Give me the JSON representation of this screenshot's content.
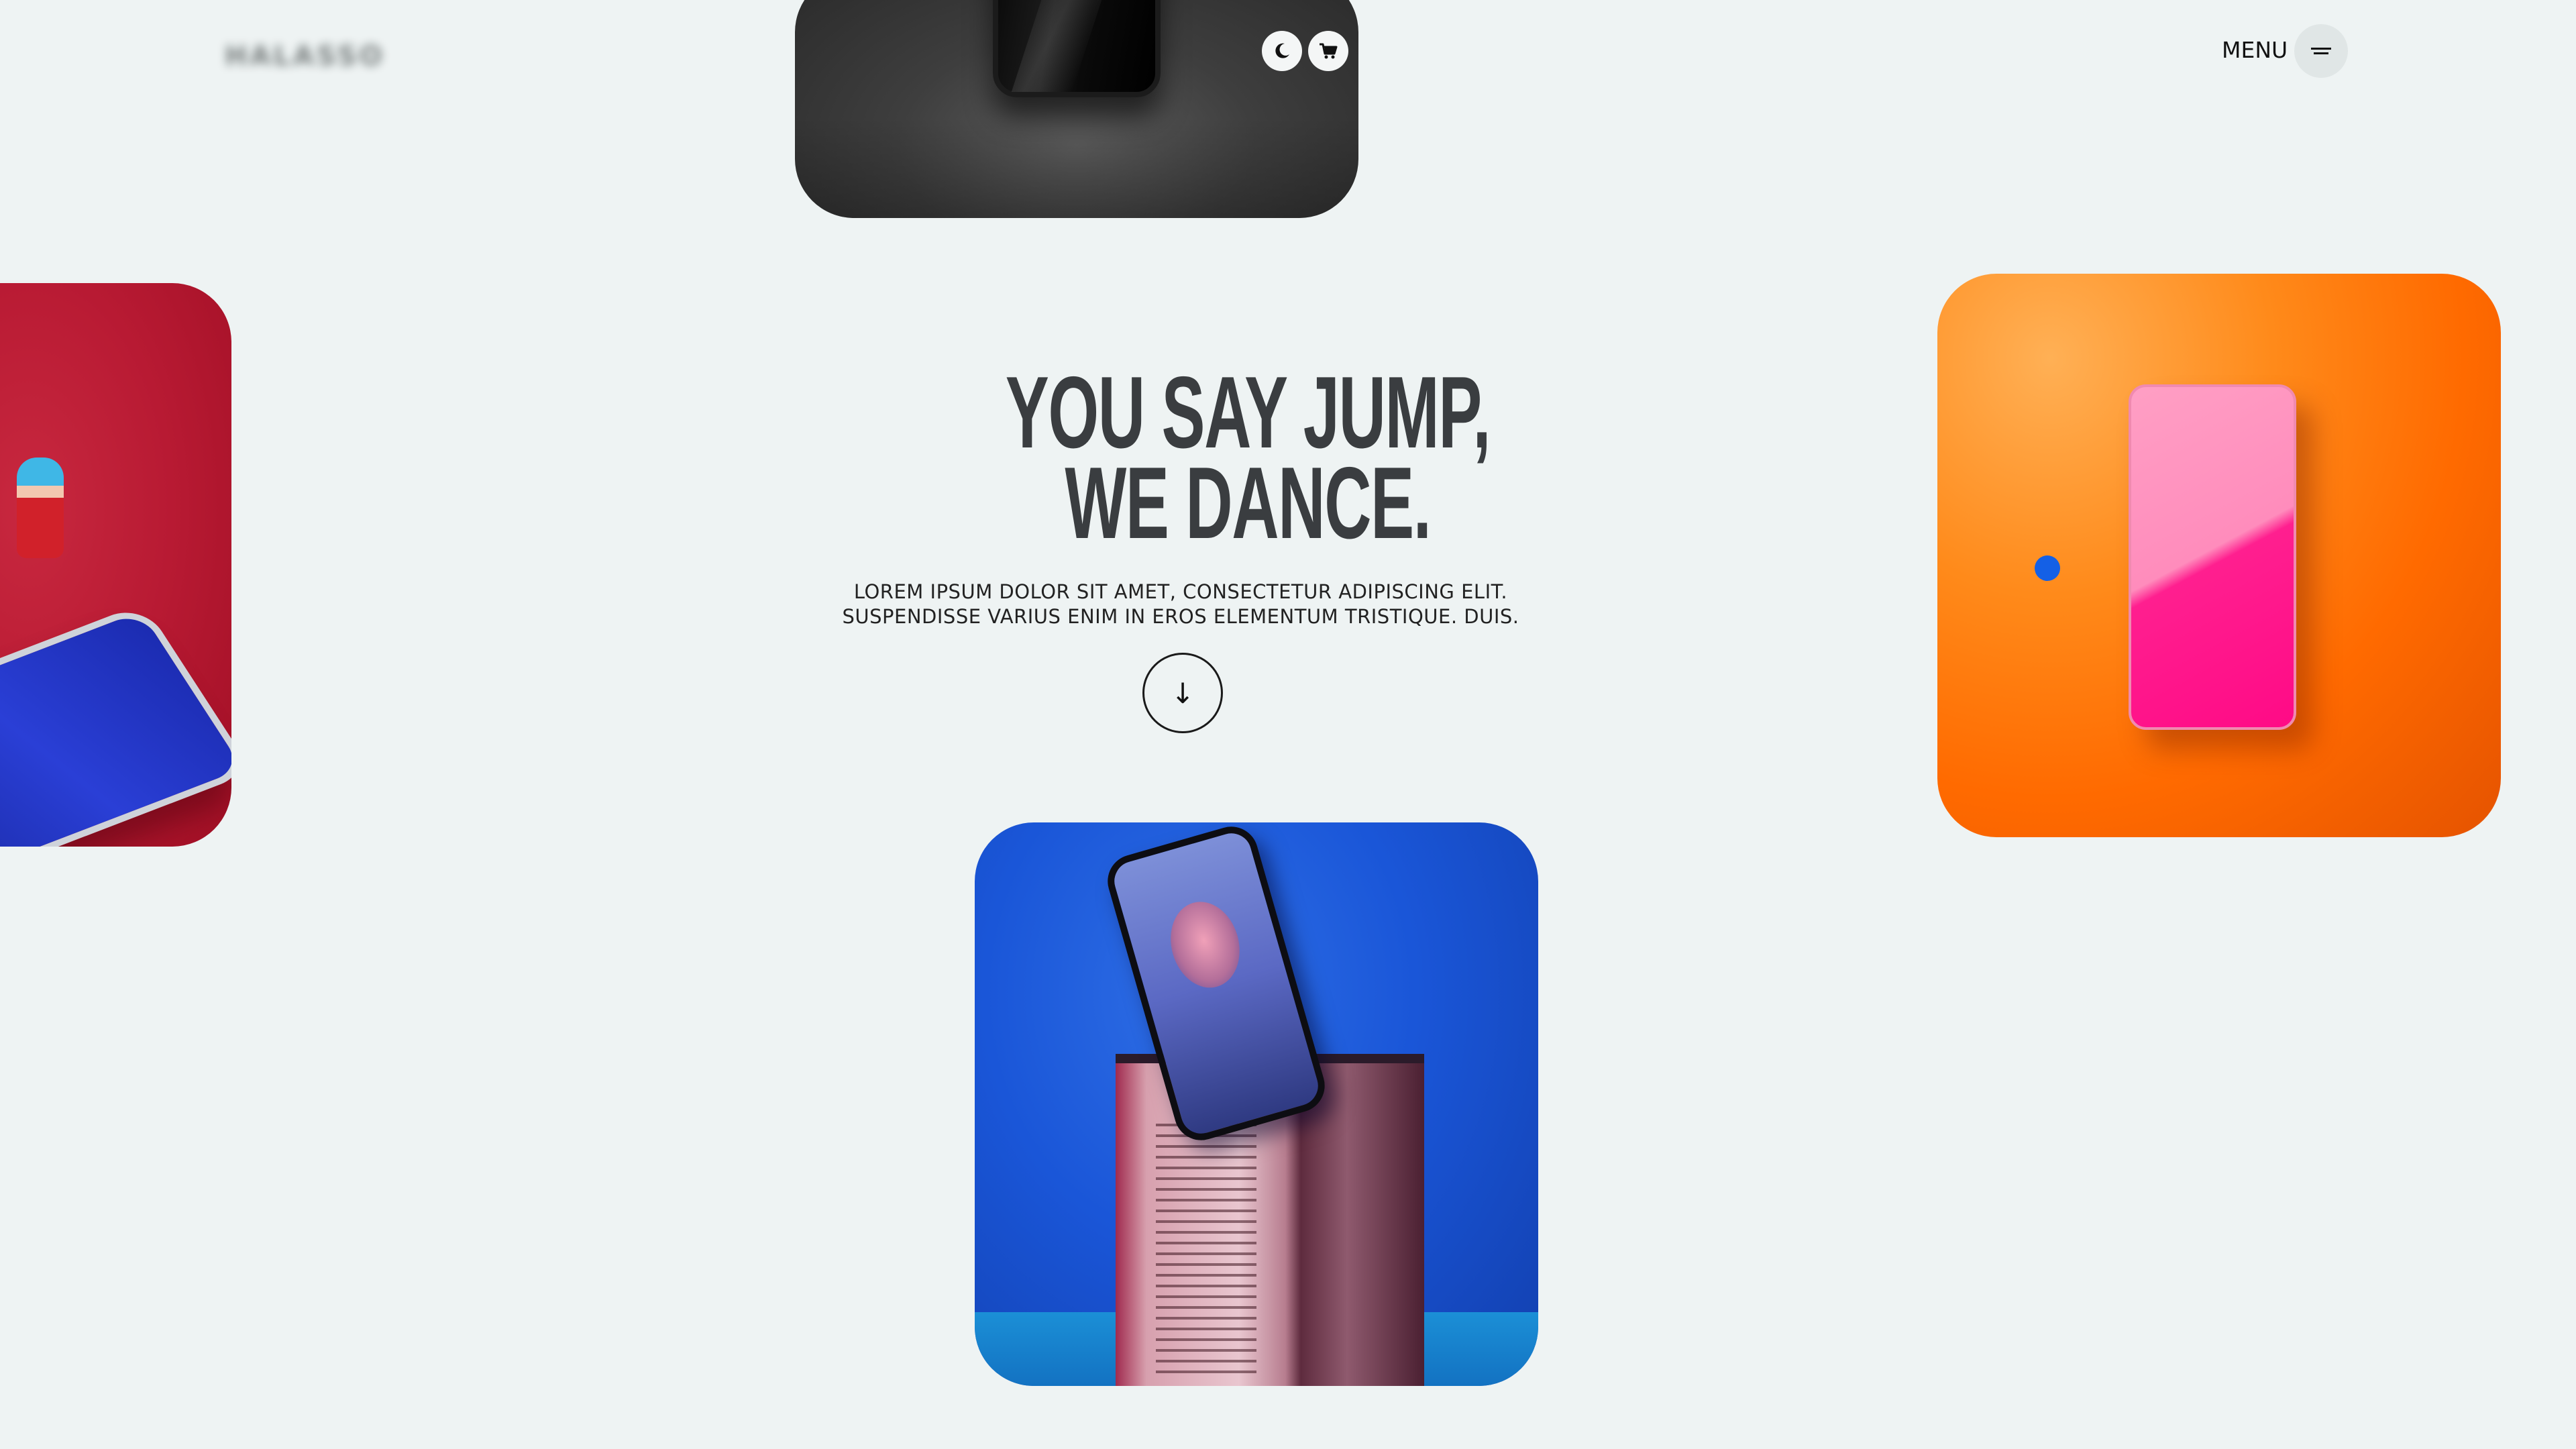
{
  "brand": {
    "logo_text": "HALASSO"
  },
  "header": {
    "menu_label": "MENU",
    "theme_toggle_icon": "moon-icon",
    "cart_icon": "cart-icon",
    "menu_icon": "hamburger-icon"
  },
  "hero": {
    "headline_line1": "YOU SAY JUMP,",
    "headline_line2": "WE DANCE.",
    "subtext_line1": "LOREM IPSUM DOLOR SIT AMET, CONSECTETUR ADIPISCING ELIT.",
    "subtext_line2": "SUSPENDISSE VARIUS ENIM IN EROS ELEMENTUM TRISTIQUE. DUIS.",
    "scroll_glyph": "↓"
  },
  "cards": [
    {
      "name": "dark-phone-card",
      "color": "#3e3e3e"
    },
    {
      "name": "red-phone-card",
      "color": "#b81a33"
    },
    {
      "name": "orange-phone-card",
      "color": "#ff6a00"
    },
    {
      "name": "blue-book-phone-card",
      "color": "#1a56d8"
    }
  ],
  "colors": {
    "background": "#eef3f3",
    "headline": "#3a3d40",
    "accent_dot": "#1460e6"
  }
}
